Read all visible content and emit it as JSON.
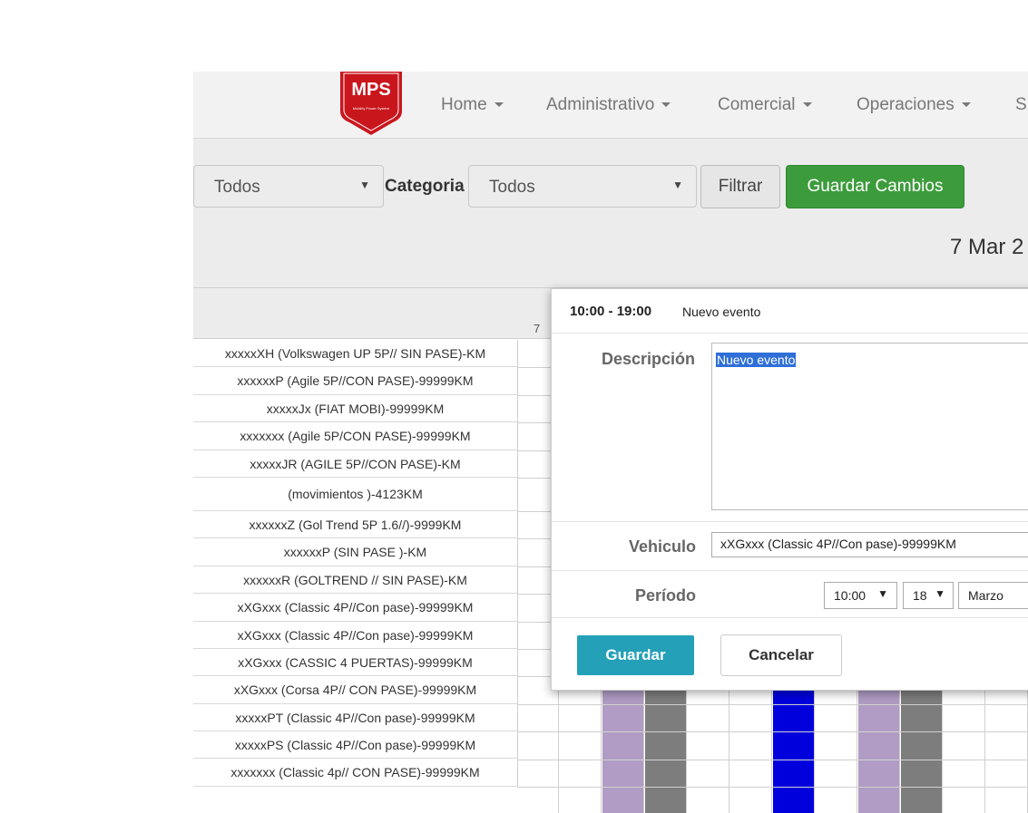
{
  "brand": {
    "logo_text": "MPS",
    "logo_subtext": "Mobility Power System"
  },
  "nav": {
    "items": [
      {
        "label": "Home"
      },
      {
        "label": "Administrativo"
      },
      {
        "label": "Comercial"
      },
      {
        "label": "Operaciones"
      },
      {
        "label": "S"
      }
    ]
  },
  "filters": {
    "first_select_value": "Todos",
    "category_label": "Categoria",
    "category_select_value": "Todos",
    "filter_button": "Filtrar",
    "save_changes_button": "Guardar Cambios"
  },
  "calendar": {
    "date_title": "7 Mar 2",
    "day_number": "7",
    "resources": [
      "xxxxxXH (Volkswagen UP 5P// SIN PASE)-KM",
      "xxxxxxP (Agile 5P//CON PASE)-99999KM",
      "xxxxxJx (FIAT MOBI)-99999KM",
      "xxxxxxx (Agile 5P/CON PASE)-99999KM",
      "xxxxxJR (AGILE 5P//CON PASE)-KM",
      "(movimientos )-4123KM",
      "xxxxxxZ (Gol Trend 5P 1.6//)-9999KM",
      "xxxxxxP (SIN PASE )-KM",
      "xxxxxxR (GOLTREND // SIN PASE)-KM",
      "xXGxxx (Classic 4P//Con pase)-99999KM",
      "xXGxxx (Classic 4P//Con pase)-99999KM",
      "xXGxxx (CASSIC 4 PUERTAS)-99999KM",
      "xXGxxx (Corsa 4P// CON PASE)-99999KM",
      "xxxxxPT (Classic 4P//Con pase)-99999KM",
      "xxxxxPS (Classic 4P//Con pase)-99999KM",
      "xxxxxxx (Classic 4p// CON PASE)-99999KM"
    ],
    "colors": {
      "lavender": "#b09cc4",
      "gray": "#7d7d7d",
      "blue": "#0000dd"
    }
  },
  "event_popup": {
    "time": "10:00 - 19:00",
    "title": "Nuevo evento",
    "description_label": "Descripción",
    "description_value": "Nuevo evento",
    "vehicle_label": "Vehiculo",
    "vehicle_value": "xXGxxx (Classic 4P//Con pase)-99999KM",
    "period_label": "Período",
    "period_time": "10:00",
    "period_day": "18",
    "period_month": "Marzo",
    "save_button": "Guardar",
    "cancel_button": "Cancelar"
  }
}
